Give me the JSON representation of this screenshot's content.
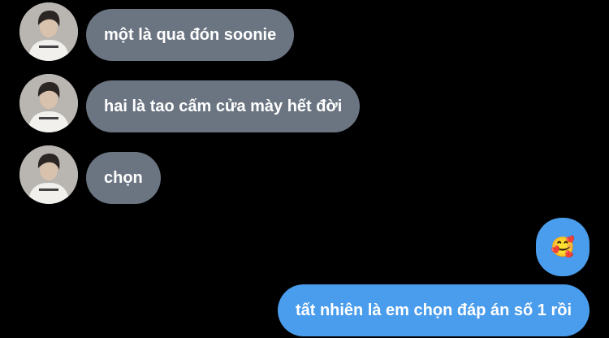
{
  "colors": {
    "background": "#000000",
    "incoming_bubble": "#6b7582",
    "outgoing_bubble": "#4a9cec",
    "text": "#ffffff"
  },
  "messages": [
    {
      "side": "incoming",
      "text": "một là qua đón soonie"
    },
    {
      "side": "incoming",
      "text": "hai là tao cấm cửa mày hết đời"
    },
    {
      "side": "incoming",
      "text": "chọn"
    },
    {
      "side": "outgoing",
      "text": "🥰",
      "icon": "smiling-face-with-hearts-emoji"
    },
    {
      "side": "outgoing",
      "text": "tất nhiên là em chọn đáp án số 1 rồi"
    }
  ]
}
